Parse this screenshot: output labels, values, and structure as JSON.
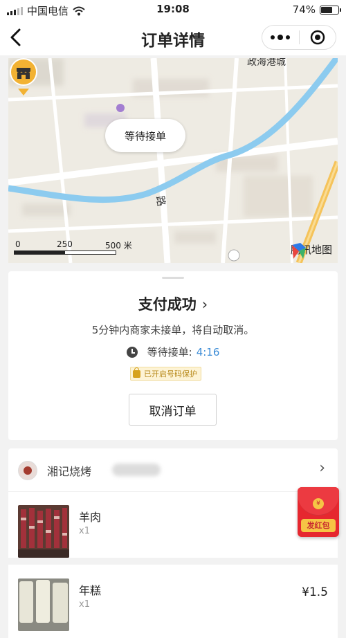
{
  "status_bar": {
    "carrier": "中国电信",
    "time": "19:08",
    "battery": "74%",
    "battery_level": 0.74
  },
  "nav": {
    "title": "订单详情",
    "back_icon": "chevron-left-icon",
    "more_icon": "more-dots-icon",
    "close_icon": "target-circle-icon"
  },
  "map": {
    "bubble_text": "等待接单",
    "scale_labels": [
      "0",
      "250",
      "500 米"
    ],
    "road_label": "路",
    "top_label": "政海港城",
    "provider": "腾讯地图",
    "colors": {
      "river": "#8ccbef",
      "road": "#ffffff",
      "highway": "#f5c35a",
      "marker": "#f2b233"
    }
  },
  "order": {
    "status_title": "支付成功",
    "notice": "5分钟内商家未接单，将自动取消。",
    "waiting_label": "等待接单:",
    "waiting_time": "4:16",
    "privacy_tag": "已开启号码保护",
    "cancel_button": "取消订单"
  },
  "shop": {
    "name": "湘记烧烤",
    "items": [
      {
        "name": "羊肉",
        "qty": "x1",
        "price": ""
      },
      {
        "name": "年糕",
        "qty": "x1",
        "price": "¥1.5"
      }
    ]
  },
  "red_packet": {
    "label": "发红包",
    "coin": "¥",
    "color": "#e6272f"
  }
}
